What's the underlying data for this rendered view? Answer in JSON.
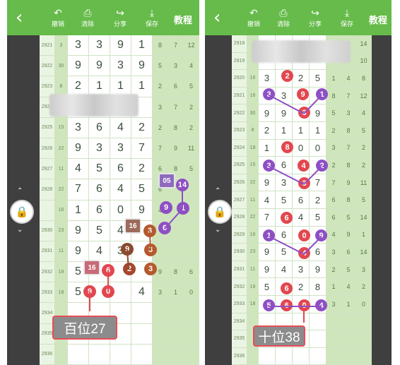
{
  "toolbar": {
    "undo_label": "撤销",
    "clear_label": "清除",
    "share_label": "分享",
    "save_label": "保存",
    "tutorial_label": "教程",
    "icons": {
      "back": "chevron-left-icon",
      "undo": "undo-icon",
      "clear": "trash-icon",
      "share": "share-icon",
      "save": "download-icon",
      "lock": "lock-icon"
    }
  },
  "left_panel": {
    "annotation_label": "百位27",
    "rows": [
      {
        "issue": "2921",
        "rn": "3",
        "d": [
          "3",
          "3",
          "9",
          "1"
        ],
        "m": [
          "8",
          "7",
          "12"
        ]
      },
      {
        "issue": "2922",
        "rn": "30",
        "d": [
          "9",
          "9",
          "3",
          "9"
        ],
        "m": [
          "5",
          "3",
          "4"
        ]
      },
      {
        "issue": "2923",
        "rn": "8",
        "d": [
          "2",
          "1",
          "1",
          "1"
        ],
        "m": [
          "2",
          "6",
          "5"
        ]
      },
      {
        "issue": "2924",
        "rn": "",
        "d": [
          "",
          "",
          "",
          ""
        ],
        "m": [
          "3",
          "7",
          "2"
        ]
      },
      {
        "issue": "2925",
        "rn": "15",
        "d": [
          "3",
          "6",
          "4",
          "2"
        ],
        "m": [
          "2",
          "8",
          "2"
        ]
      },
      {
        "issue": "2926",
        "rn": "22",
        "d": [
          "9",
          "3",
          "3",
          "7"
        ],
        "m": [
          "7",
          "9",
          "11"
        ]
      },
      {
        "issue": "2927",
        "rn": "11",
        "d": [
          "4",
          "5",
          "6",
          "2"
        ],
        "m": [
          "6",
          "8",
          "5"
        ]
      },
      {
        "issue": "2928",
        "rn": "22",
        "d": [
          "7",
          "6",
          "4",
          "5"
        ],
        "m": [
          "6",
          "",
          ""
        ]
      },
      {
        "issue": "",
        "rn": "16",
        "d": [
          "1",
          "6",
          "0",
          "9"
        ],
        "m": [
          "4",
          "",
          ""
        ]
      },
      {
        "issue": "2930",
        "rn": "23",
        "d": [
          "9",
          "5",
          "4",
          ""
        ],
        "m": [
          "",
          "",
          ""
        ]
      },
      {
        "issue": "2931",
        "rn": "11",
        "d": [
          "9",
          "4",
          "3",
          ""
        ],
        "m": [
          "",
          "",
          ""
        ]
      },
      {
        "issue": "2932",
        "rn": "19",
        "d": [
          "5",
          "",
          "",
          ""
        ],
        "m": [
          "9",
          "8",
          "6"
        ]
      },
      {
        "issue": "2933",
        "rn": "18",
        "d": [
          "5",
          "",
          "",
          "4"
        ],
        "m": [
          "3",
          "1",
          "0"
        ]
      },
      {
        "issue": "2934",
        "rn": "",
        "d": [
          "",
          "",
          "",
          ""
        ],
        "m": [
          "",
          "",
          ""
        ]
      },
      {
        "issue": "2935",
        "rn": "",
        "d": [
          "",
          "",
          "",
          ""
        ],
        "m": [
          "",
          "",
          ""
        ]
      },
      {
        "issue": "2936",
        "rn": "",
        "d": [
          "",
          "",
          "",
          ""
        ],
        "m": [
          "",
          "",
          ""
        ]
      }
    ],
    "balls": [
      {
        "t": "05",
        "c": "#8e6bbf",
        "sq": true
      },
      {
        "t": "14",
        "c": "#8e4fc4"
      },
      {
        "t": "9",
        "c": "#8e4fc4"
      },
      {
        "t": "1",
        "c": "#8e4fc4"
      },
      {
        "t": "6",
        "c": "#8e4fc4"
      },
      {
        "t": "16",
        "c": "#9c6b5a",
        "sq": true
      },
      {
        "t": "3",
        "c": "#b5592e"
      },
      {
        "t": "3",
        "c": "#b5592e"
      },
      {
        "t": "9",
        "c": "#8a4a2e"
      },
      {
        "t": "3",
        "c": "#b5592e"
      },
      {
        "t": "16",
        "c": "#c86a78",
        "sq": true
      },
      {
        "t": "6",
        "c": "#e2474f"
      },
      {
        "t": "2",
        "c": "#a5472e"
      },
      {
        "t": "9",
        "c": "#e2474f"
      },
      {
        "t": "0",
        "c": "#e2474f"
      }
    ]
  },
  "right_panel": {
    "annotation_label": "十位38",
    "rows": [
      {
        "issue": "2918",
        "rn": "",
        "d": [
          "",
          "",
          "",
          ""
        ],
        "m": [
          "",
          "",
          "14"
        ]
      },
      {
        "issue": "2919",
        "rn": "",
        "d": [
          "",
          "",
          "",
          ""
        ],
        "m": [
          "",
          "",
          "10"
        ]
      },
      {
        "issue": "2920",
        "rn": "16",
        "d": [
          "3",
          "",
          "2",
          "5"
        ],
        "m": [
          "1",
          "4",
          "8"
        ]
      },
      {
        "issue": "2921",
        "rn": "16",
        "d": [
          "",
          "3",
          "",
          ""
        ],
        "m": [
          "8",
          "7",
          "12"
        ]
      },
      {
        "issue": "2922",
        "rn": "30",
        "d": [
          "9",
          "9",
          "",
          "9"
        ],
        "m": [
          "5",
          "3",
          "4"
        ]
      },
      {
        "issue": "2923",
        "rn": "8",
        "d": [
          "2",
          "1",
          "1",
          "1"
        ],
        "m": [
          "2",
          "8",
          "5"
        ]
      },
      {
        "issue": "2924",
        "rn": "18",
        "d": [
          "1",
          "",
          "0",
          "0"
        ],
        "m": [
          "3",
          "7",
          "2"
        ]
      },
      {
        "issue": "2925",
        "rn": "15",
        "d": [
          "",
          "6",
          "",
          ""
        ],
        "m": [
          "2",
          "8",
          "2"
        ]
      },
      {
        "issue": "2926",
        "rn": "22",
        "d": [
          "9",
          "3",
          "",
          "7"
        ],
        "m": [
          "7",
          "9",
          "11"
        ]
      },
      {
        "issue": "2927",
        "rn": "11",
        "d": [
          "4",
          "5",
          "6",
          "2"
        ],
        "m": [
          "6",
          "8",
          "5"
        ]
      },
      {
        "issue": "2928",
        "rn": "22",
        "d": [
          "7",
          "",
          "4",
          "5"
        ],
        "m": [
          "6",
          "5",
          "14"
        ]
      },
      {
        "issue": "2929",
        "rn": "16",
        "d": [
          "",
          "6",
          "",
          ""
        ],
        "m": [
          "4",
          "9",
          "1"
        ]
      },
      {
        "issue": "2930",
        "rn": "23",
        "d": [
          "9",
          "5",
          "",
          "6"
        ],
        "m": [
          "3",
          "6",
          "14"
        ]
      },
      {
        "issue": "2931",
        "rn": "11",
        "d": [
          "9",
          "4",
          "3",
          "9"
        ],
        "m": [
          "2",
          "5",
          "3"
        ]
      },
      {
        "issue": "2932",
        "rn": "19",
        "d": [
          "5",
          "",
          "2",
          "8"
        ],
        "m": [
          "1",
          "4",
          "2"
        ]
      },
      {
        "issue": "2933",
        "rn": "18",
        "d": [
          "5",
          "",
          "",
          ""
        ],
        "m": [
          "3",
          "1",
          "0"
        ]
      },
      {
        "issue": "2934",
        "rn": "",
        "d": [
          "",
          "",
          "",
          ""
        ],
        "m": [
          "",
          "",
          ""
        ]
      },
      {
        "issue": "2935",
        "rn": "",
        "d": [
          "",
          "",
          "",
          ""
        ],
        "m": [
          "",
          "",
          ""
        ]
      },
      {
        "issue": "2936",
        "rn": "",
        "d": [
          "",
          "",
          "",
          ""
        ],
        "m": [
          "",
          "",
          ""
        ]
      }
    ],
    "balls": [
      {
        "t": "2",
        "c": "#e2474f"
      },
      {
        "t": "3",
        "c": "#8e4fc4"
      },
      {
        "t": "9",
        "c": "#e2474f"
      },
      {
        "t": "1",
        "c": "#8e4fc4"
      },
      {
        "t": "3",
        "c": "#e2474f"
      },
      {
        "t": "8",
        "c": "#e2474f"
      },
      {
        "t": "3",
        "c": "#8e4fc4"
      },
      {
        "t": "4",
        "c": "#e2474f"
      },
      {
        "t": "2",
        "c": "#8e4fc4"
      },
      {
        "t": "3",
        "c": "#e2474f"
      },
      {
        "t": "6",
        "c": "#e2474f"
      },
      {
        "t": "1",
        "c": "#8e4fc4"
      },
      {
        "t": "0",
        "c": "#e2474f"
      },
      {
        "t": "9",
        "c": "#8e4fc4"
      },
      {
        "t": "4",
        "c": "#e2474f"
      },
      {
        "t": "6",
        "c": "#e2474f"
      },
      {
        "t": "5",
        "c": "#8e4fc4"
      },
      {
        "t": "6",
        "c": "#e2474f"
      },
      {
        "t": "0",
        "c": "#e2474f"
      },
      {
        "t": "4",
        "c": "#8e4fc4"
      }
    ]
  },
  "colors": {
    "header": "#66bb4a",
    "grid_line": "#cfe3c4",
    "miss_cell": "#cfe6bc",
    "red_ball": "#e2474f",
    "purple_ball": "#8e4fc4",
    "label_border": "#e94d57"
  }
}
